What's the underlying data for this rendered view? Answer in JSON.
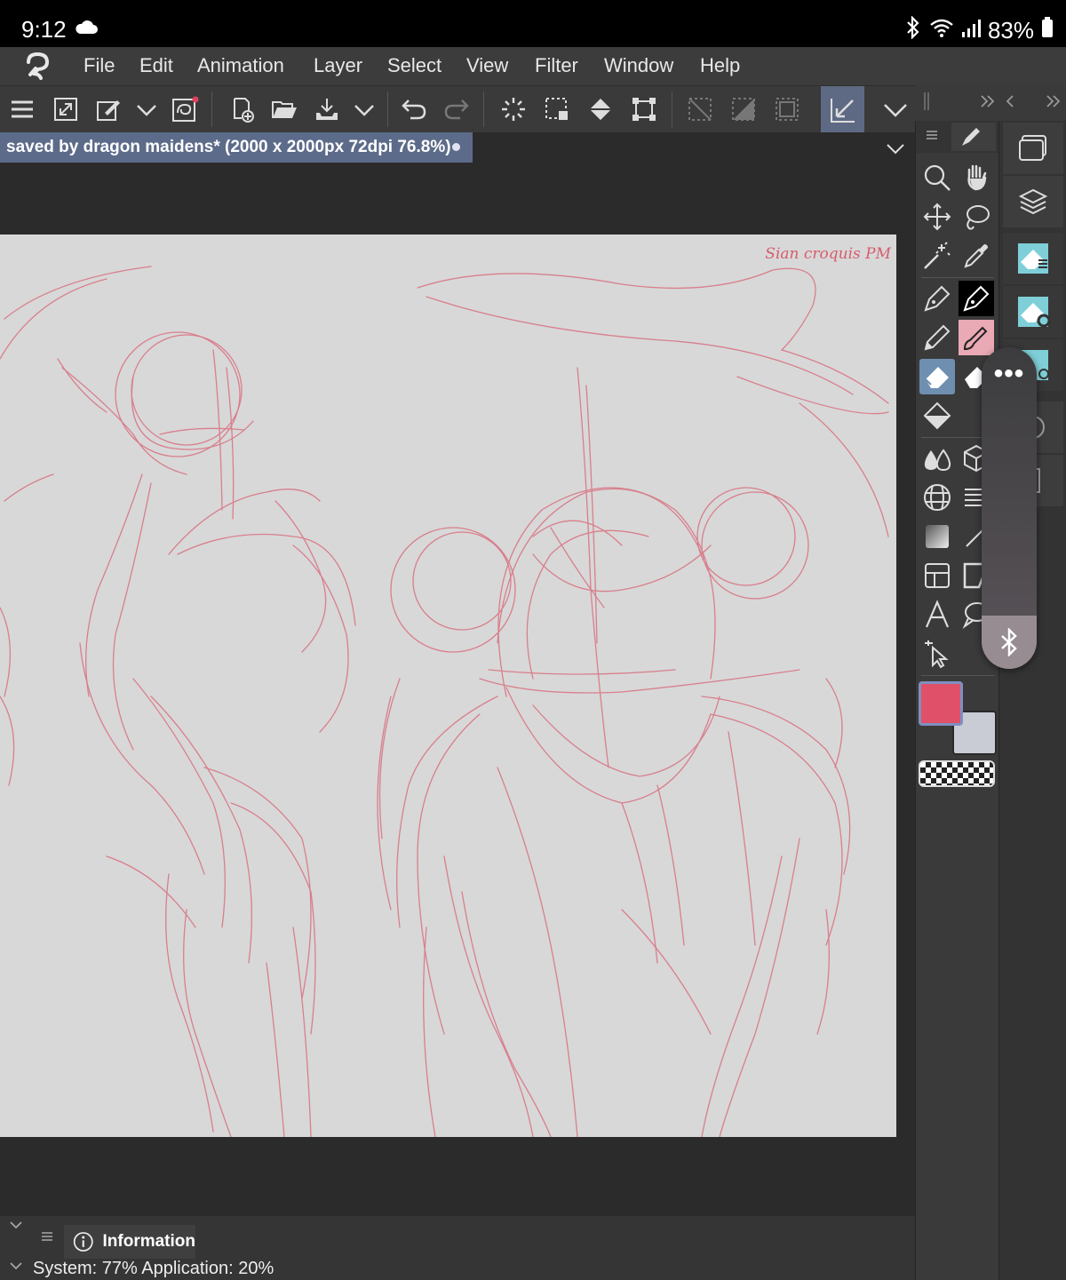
{
  "status_bar": {
    "time": "9:12",
    "battery": "83%"
  },
  "menu": {
    "items": [
      "File",
      "Edit",
      "Animation",
      "Layer",
      "Select",
      "View",
      "Filter",
      "Window",
      "Help"
    ]
  },
  "document": {
    "tab_title": "saved by dragon maidens* (2000 x 2000px 72dpi 76.8%)"
  },
  "canvas": {
    "signature": "Sian croquis PM"
  },
  "colors": {
    "main": "#e05068",
    "sub": "#c9ccd4",
    "accent": "#5c6b89"
  },
  "info_panel": {
    "tab_label": "Information",
    "status": "System: 77%  Application: 20%"
  },
  "tools": {
    "icons": [
      "zoom-icon",
      "hand-icon",
      "move-icon",
      "lasso-icon",
      "magic-wand-icon",
      "eyedropper-icon",
      "pen-icon",
      "pen-dark-icon",
      "pencil-icon",
      "brush-icon",
      "eraser-icon",
      "eraser-alt-icon",
      "fill-icon",
      "blend-icon",
      "3d-icon",
      "perspective-grid-icon",
      "line-pattern-icon",
      "gradient-icon",
      "ruler-icon",
      "frame-icon",
      "panel-icon",
      "text-icon",
      "balloon-icon",
      "operation-icon"
    ]
  }
}
